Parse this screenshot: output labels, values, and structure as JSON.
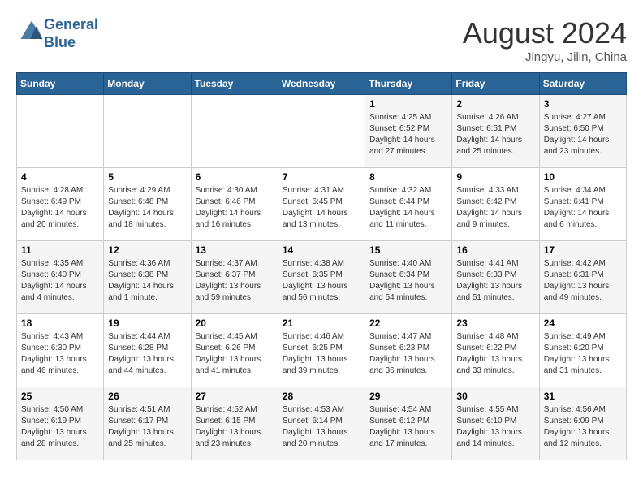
{
  "header": {
    "logo_line1": "General",
    "logo_line2": "Blue",
    "month_title": "August 2024",
    "location": "Jingyu, Jilin, China"
  },
  "days_of_week": [
    "Sunday",
    "Monday",
    "Tuesday",
    "Wednesday",
    "Thursday",
    "Friday",
    "Saturday"
  ],
  "weeks": [
    [
      {
        "day": "",
        "info": ""
      },
      {
        "day": "",
        "info": ""
      },
      {
        "day": "",
        "info": ""
      },
      {
        "day": "",
        "info": ""
      },
      {
        "day": "1",
        "info": "Sunrise: 4:25 AM\nSunset: 6:52 PM\nDaylight: 14 hours\nand 27 minutes."
      },
      {
        "day": "2",
        "info": "Sunrise: 4:26 AM\nSunset: 6:51 PM\nDaylight: 14 hours\nand 25 minutes."
      },
      {
        "day": "3",
        "info": "Sunrise: 4:27 AM\nSunset: 6:50 PM\nDaylight: 14 hours\nand 23 minutes."
      }
    ],
    [
      {
        "day": "4",
        "info": "Sunrise: 4:28 AM\nSunset: 6:49 PM\nDaylight: 14 hours\nand 20 minutes."
      },
      {
        "day": "5",
        "info": "Sunrise: 4:29 AM\nSunset: 6:48 PM\nDaylight: 14 hours\nand 18 minutes."
      },
      {
        "day": "6",
        "info": "Sunrise: 4:30 AM\nSunset: 6:46 PM\nDaylight: 14 hours\nand 16 minutes."
      },
      {
        "day": "7",
        "info": "Sunrise: 4:31 AM\nSunset: 6:45 PM\nDaylight: 14 hours\nand 13 minutes."
      },
      {
        "day": "8",
        "info": "Sunrise: 4:32 AM\nSunset: 6:44 PM\nDaylight: 14 hours\nand 11 minutes."
      },
      {
        "day": "9",
        "info": "Sunrise: 4:33 AM\nSunset: 6:42 PM\nDaylight: 14 hours\nand 9 minutes."
      },
      {
        "day": "10",
        "info": "Sunrise: 4:34 AM\nSunset: 6:41 PM\nDaylight: 14 hours\nand 6 minutes."
      }
    ],
    [
      {
        "day": "11",
        "info": "Sunrise: 4:35 AM\nSunset: 6:40 PM\nDaylight: 14 hours\nand 4 minutes."
      },
      {
        "day": "12",
        "info": "Sunrise: 4:36 AM\nSunset: 6:38 PM\nDaylight: 14 hours\nand 1 minute."
      },
      {
        "day": "13",
        "info": "Sunrise: 4:37 AM\nSunset: 6:37 PM\nDaylight: 13 hours\nand 59 minutes."
      },
      {
        "day": "14",
        "info": "Sunrise: 4:38 AM\nSunset: 6:35 PM\nDaylight: 13 hours\nand 56 minutes."
      },
      {
        "day": "15",
        "info": "Sunrise: 4:40 AM\nSunset: 6:34 PM\nDaylight: 13 hours\nand 54 minutes."
      },
      {
        "day": "16",
        "info": "Sunrise: 4:41 AM\nSunset: 6:33 PM\nDaylight: 13 hours\nand 51 minutes."
      },
      {
        "day": "17",
        "info": "Sunrise: 4:42 AM\nSunset: 6:31 PM\nDaylight: 13 hours\nand 49 minutes."
      }
    ],
    [
      {
        "day": "18",
        "info": "Sunrise: 4:43 AM\nSunset: 6:30 PM\nDaylight: 13 hours\nand 46 minutes."
      },
      {
        "day": "19",
        "info": "Sunrise: 4:44 AM\nSunset: 6:28 PM\nDaylight: 13 hours\nand 44 minutes."
      },
      {
        "day": "20",
        "info": "Sunrise: 4:45 AM\nSunset: 6:26 PM\nDaylight: 13 hours\nand 41 minutes."
      },
      {
        "day": "21",
        "info": "Sunrise: 4:46 AM\nSunset: 6:25 PM\nDaylight: 13 hours\nand 39 minutes."
      },
      {
        "day": "22",
        "info": "Sunrise: 4:47 AM\nSunset: 6:23 PM\nDaylight: 13 hours\nand 36 minutes."
      },
      {
        "day": "23",
        "info": "Sunrise: 4:48 AM\nSunset: 6:22 PM\nDaylight: 13 hours\nand 33 minutes."
      },
      {
        "day": "24",
        "info": "Sunrise: 4:49 AM\nSunset: 6:20 PM\nDaylight: 13 hours\nand 31 minutes."
      }
    ],
    [
      {
        "day": "25",
        "info": "Sunrise: 4:50 AM\nSunset: 6:19 PM\nDaylight: 13 hours\nand 28 minutes."
      },
      {
        "day": "26",
        "info": "Sunrise: 4:51 AM\nSunset: 6:17 PM\nDaylight: 13 hours\nand 25 minutes."
      },
      {
        "day": "27",
        "info": "Sunrise: 4:52 AM\nSunset: 6:15 PM\nDaylight: 13 hours\nand 23 minutes."
      },
      {
        "day": "28",
        "info": "Sunrise: 4:53 AM\nSunset: 6:14 PM\nDaylight: 13 hours\nand 20 minutes."
      },
      {
        "day": "29",
        "info": "Sunrise: 4:54 AM\nSunset: 6:12 PM\nDaylight: 13 hours\nand 17 minutes."
      },
      {
        "day": "30",
        "info": "Sunrise: 4:55 AM\nSunset: 6:10 PM\nDaylight: 13 hours\nand 14 minutes."
      },
      {
        "day": "31",
        "info": "Sunrise: 4:56 AM\nSunset: 6:09 PM\nDaylight: 13 hours\nand 12 minutes."
      }
    ]
  ]
}
